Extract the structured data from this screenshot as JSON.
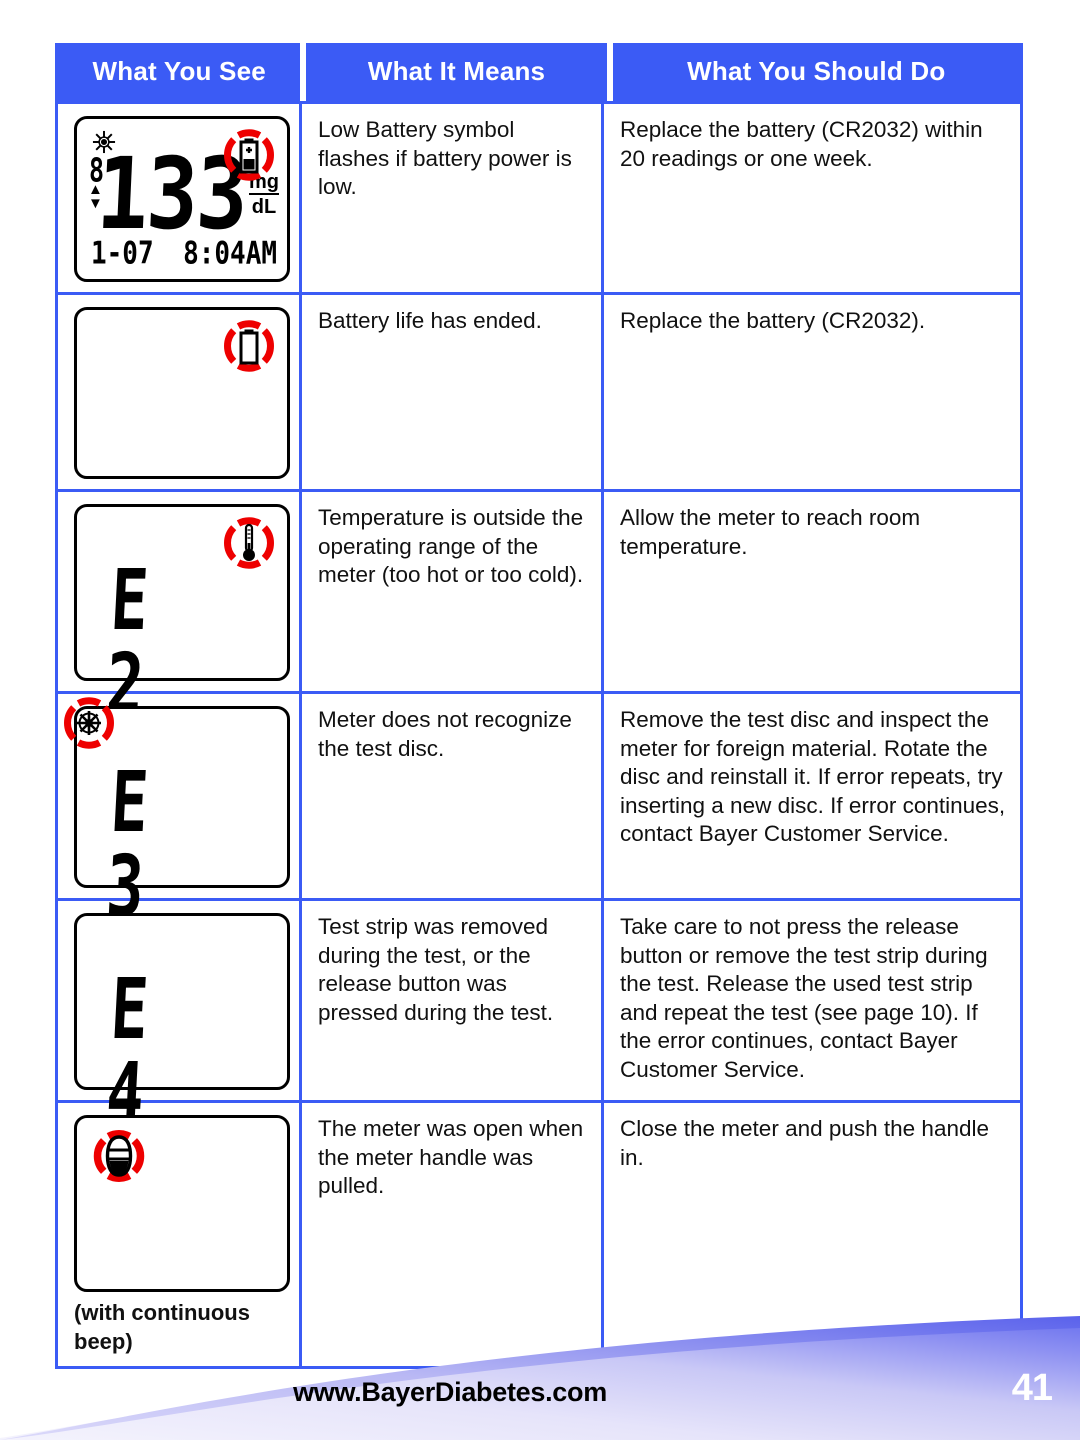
{
  "document": {
    "footer": {
      "website": "www.BayerDiabetes.com",
      "page_number": "41",
      "swoosh_color_light": "#eeecfb",
      "swoosh_color_dark": "#6b72ef"
    }
  },
  "table": {
    "header_color": "#3b5bf5",
    "alert_color": "#ee0000",
    "columns": [
      {
        "label": "What You See"
      },
      {
        "label": "What It Means"
      },
      {
        "label": "What You Should Do"
      }
    ],
    "rows": [
      {
        "display": {
          "kind": "reading",
          "disc_icon": "test-disc-icon",
          "memory_digit": "8",
          "value": "133",
          "unit_top": "mg",
          "unit_bottom": "dL",
          "date": "1-07",
          "time": "8:04AM",
          "alert_icon": "low-battery-icon",
          "alert_position": "top-right"
        },
        "means": "Low Battery symbol flashes if battery power is low.",
        "should_do": "Replace the battery (CR2032) within 20 readings or one week."
      },
      {
        "display": {
          "kind": "blank",
          "alert_icon": "empty-battery-icon",
          "alert_position": "top-right"
        },
        "means": "Battery life has ended.",
        "should_do": "Replace the battery (CR2032)."
      },
      {
        "display": {
          "kind": "error",
          "code": "E 2",
          "alert_icon": "thermometer-icon",
          "alert_position": "top-right"
        },
        "means": "Temperature is outside the operating range of the meter (too hot or too cold).",
        "should_do": "Allow the meter to reach room temperature."
      },
      {
        "display": {
          "kind": "error",
          "code": "E 3",
          "alert_icon": "test-disc-icon",
          "alert_position": "top-left-outside"
        },
        "means": "Meter does not recognize the test disc.",
        "should_do": "Remove the test disc and inspect the meter for foreign material. Rotate the disc and reinstall it. If error repeats, try inserting a new disc. If error continues, contact Bayer Customer Service."
      },
      {
        "display": {
          "kind": "error",
          "code": "E 4",
          "alert_icon": "none",
          "alert_position": "none"
        },
        "means": "Test strip was removed during the test, or the release button was pressed during the test.",
        "should_do": "Take care to not press the release button or remove the test strip during the test. Release the used test strip and repeat the test (see page 10). If the error continues, contact Bayer Customer Service."
      },
      {
        "display": {
          "kind": "blank",
          "alert_icon": "meter-open-icon",
          "alert_position": "top-left-inside",
          "caption": "(with continuous beep)"
        },
        "means": "The meter was open when the meter handle was pulled.",
        "should_do": "Close the meter and push the handle in."
      }
    ]
  }
}
